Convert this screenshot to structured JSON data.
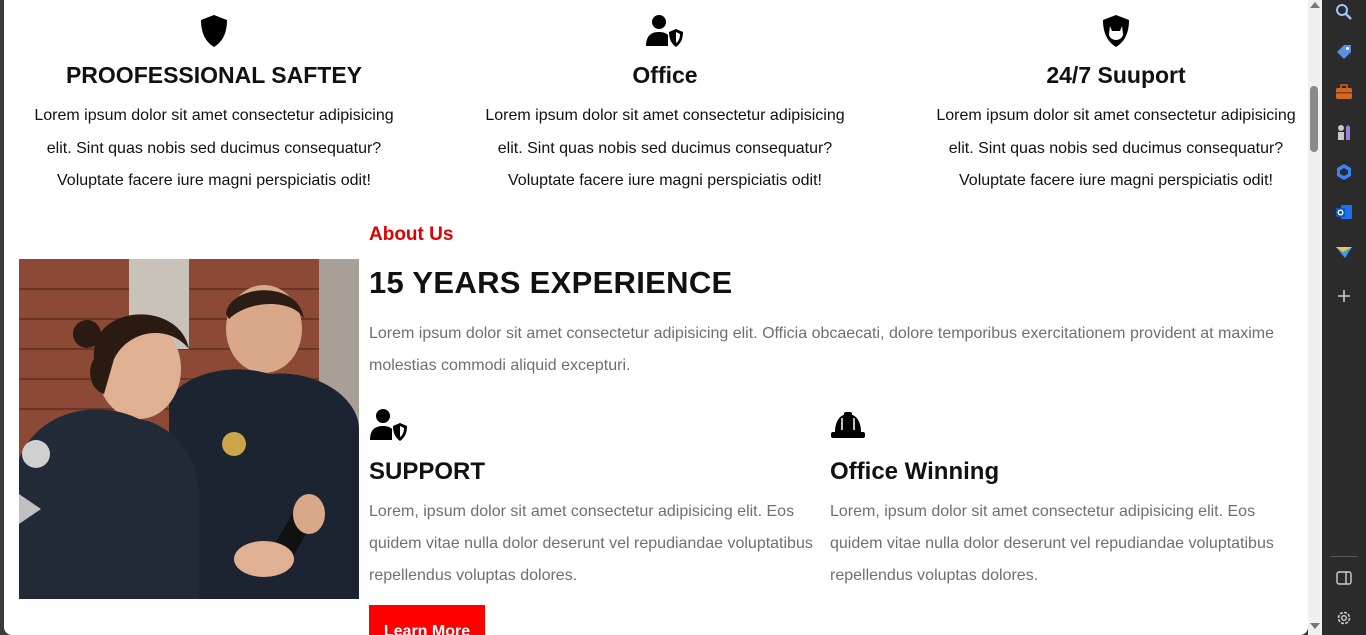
{
  "features": [
    {
      "title": "PROOFESSIONAL SAFTEY",
      "icon": "shield-icon",
      "line1": "Lorem ipsum dolor sit amet consectetur adipisicing",
      "line2": "elit. Sint quas nobis sed ducimus consequatur?",
      "line3": "Voluptate facere iure magni perspiciatis odit!"
    },
    {
      "title": "Office",
      "icon": "user-shield-icon",
      "line1": "Lorem ipsum dolor sit amet consectetur adipisicing",
      "line2": "elit. Sint quas nobis sed ducimus consequatur?",
      "line3": "Voluptate facere iure magni perspiciatis odit!"
    },
    {
      "title": "24/7 Suuport",
      "icon": "shield-cat-icon",
      "line1": "Lorem ipsum dolor sit amet consectetur adipisicing",
      "line2": "elit. Sint quas nobis sed ducimus consequatur?",
      "line3": "Voluptate facere iure magni perspiciatis odit!"
    }
  ],
  "about": {
    "label": "About Us",
    "title": "15 YEARS EXPERIENCE",
    "desc": "Lorem ipsum dolor sit amet consectetur adipisicing elit. Officia obcaecati, dolore temporibus exercitationem provident at maxime molestias commodi aliquid excepturi.",
    "items": [
      {
        "title": "SUPPORT",
        "icon": "user-shield-icon",
        "text": "Lorem, ipsum dolor sit amet consectetur adipisicing elit. Eos quidem vitae nulla dolor deserunt vel repudiandae voluptatibus repellendus voluptas dolores."
      },
      {
        "title": "Office Winning",
        "icon": "hard-hat-icon",
        "text": "Lorem, ipsum dolor sit amet consectetur adipisicing elit. Eos quidem vitae nulla dolor deserunt vel repudiandae voluptatibus repellendus voluptas dolores."
      }
    ],
    "button": "Learn More"
  },
  "sidebar_icons": [
    "search-icon",
    "tag-icon",
    "briefcase-icon",
    "chess-icon",
    "copilot-icon",
    "outlook-icon",
    "send-icon",
    "add-icon",
    "panel-icon",
    "settings-icon"
  ],
  "colors": {
    "accent": "#ff0000",
    "label": "#e00000",
    "muted_text": "#6f6f6f",
    "sidebar": "#2b2b2b"
  }
}
